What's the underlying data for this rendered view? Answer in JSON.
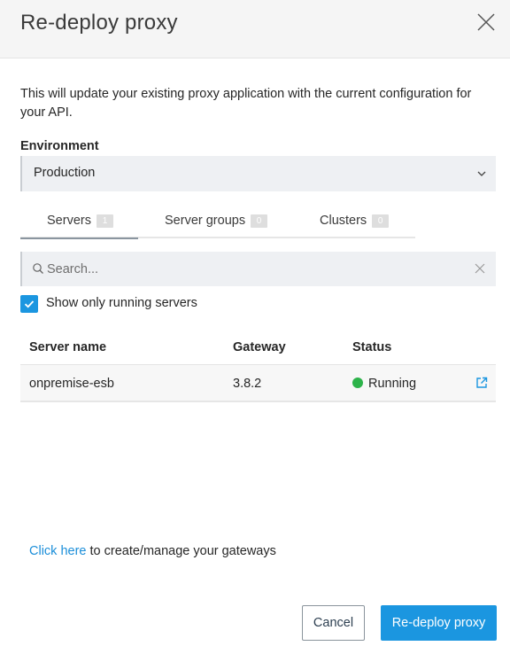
{
  "dialog": {
    "title": "Re-deploy proxy",
    "description": "This will update your existing proxy application with the current configuration for your API."
  },
  "environment": {
    "label": "Environment",
    "selected": "Production"
  },
  "tabs": [
    {
      "label": "Servers",
      "count": "1",
      "active": true
    },
    {
      "label": "Server groups",
      "count": "0",
      "active": false
    },
    {
      "label": "Clusters",
      "count": "0",
      "active": false
    }
  ],
  "search": {
    "placeholder": "Search...",
    "value": ""
  },
  "filter": {
    "label": "Show only running servers",
    "checked": true
  },
  "table": {
    "columns": [
      "Server name",
      "Gateway",
      "Status"
    ],
    "rows": [
      {
        "name": "onpremise-esb",
        "gateway": "3.8.2",
        "status": "Running",
        "status_color": "#2db34a"
      }
    ]
  },
  "footer": {
    "link_text": "Click here",
    "text": "to create/manage your gateways"
  },
  "buttons": {
    "cancel": "Cancel",
    "submit": "Re-deploy proxy"
  },
  "colors": {
    "accent": "#1b96e0",
    "link": "#1b8ed9",
    "running": "#2db34a"
  },
  "icons": [
    "close-icon",
    "chevron-down-icon",
    "search-icon",
    "clear-icon",
    "checkmark-icon",
    "external-link-icon"
  ]
}
